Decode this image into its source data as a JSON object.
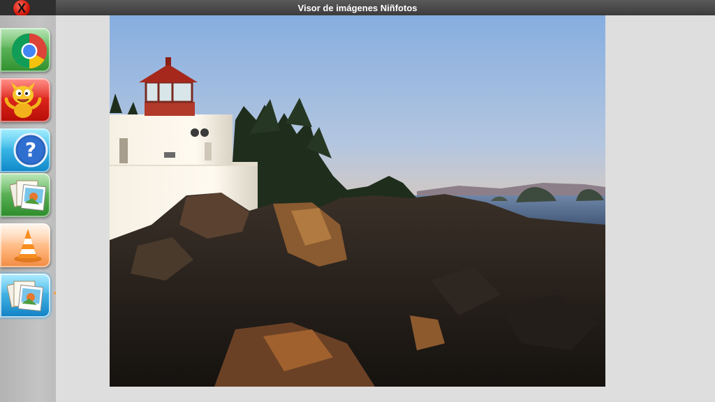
{
  "window": {
    "title": "Visor de imágenes Niñfotos",
    "close_glyph": "X"
  },
  "launcher": [
    {
      "name": "chrome",
      "icon": "chrome-icon",
      "color": "#2f8f2d"
    },
    {
      "name": "game",
      "icon": "dragon-character-icon",
      "color": "#b50d06"
    },
    {
      "name": "help",
      "icon": "help-icon",
      "color": "#0f86c8"
    },
    {
      "name": "photos",
      "icon": "photo-stack-icon",
      "color": "#2c8b2a"
    },
    {
      "name": "vlc",
      "icon": "vlc-cone-icon",
      "color": "#f08a40"
    },
    {
      "name": "image-viewer",
      "icon": "photo-stack-icon",
      "color": "#1081c4",
      "selected": true
    }
  ],
  "viewer": {
    "image": "lighthouse-coast-photo"
  }
}
